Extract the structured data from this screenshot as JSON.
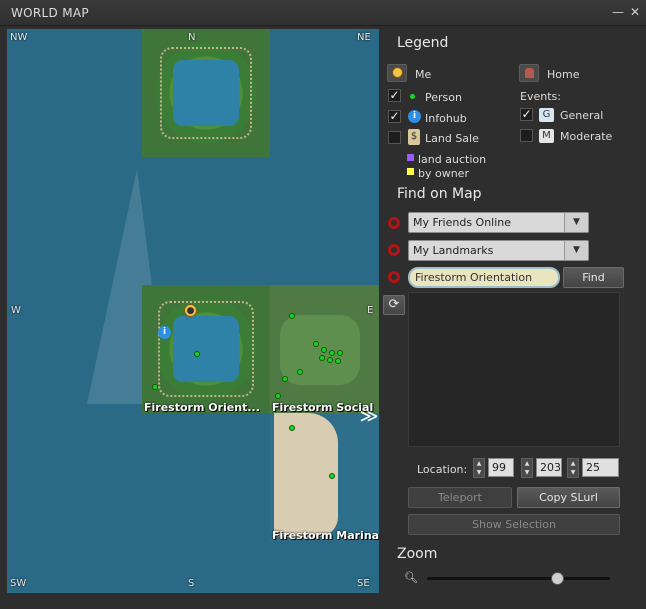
{
  "window": {
    "title": "WORLD MAP",
    "minimize": "—",
    "close": "✕"
  },
  "map": {
    "compass": {
      "nw": "NW",
      "n": "N",
      "ne": "NE",
      "w": "W",
      "e": "E",
      "sw": "SW",
      "s": "S",
      "se": "SE"
    },
    "regions": [
      "Firestorm Orient...",
      "Firestorm Social",
      "Firestorm Marina"
    ],
    "expand_label": "≫"
  },
  "legend": {
    "title": "Legend",
    "me": "Me",
    "home": "Home",
    "person": "Person",
    "infohub": "Infohub",
    "land_sale": "Land Sale",
    "land_auction": "land auction",
    "by_owner": "by owner",
    "events": "Events:",
    "general": "General",
    "moderate": "Moderate",
    "general_letter": "G",
    "moderate_letter": "M"
  },
  "find": {
    "title": "Find on Map",
    "friends": "My Friends Online",
    "landmarks": "My Landmarks",
    "search_value": "Firestorm Orientation",
    "find_button": "Find"
  },
  "location": {
    "label": "Location:",
    "x": "99",
    "y": "203",
    "z": "25"
  },
  "buttons": {
    "teleport": "Teleport",
    "copy_slurl": "Copy SLurl",
    "show_selection": "Show Selection"
  },
  "zoom": {
    "title": "Zoom",
    "level": 0.71
  },
  "colors": {
    "auction": "#9b5cff",
    "by_owner": "#ffff44",
    "person_dot": "#19d41d",
    "red_marker": "#b01515"
  }
}
